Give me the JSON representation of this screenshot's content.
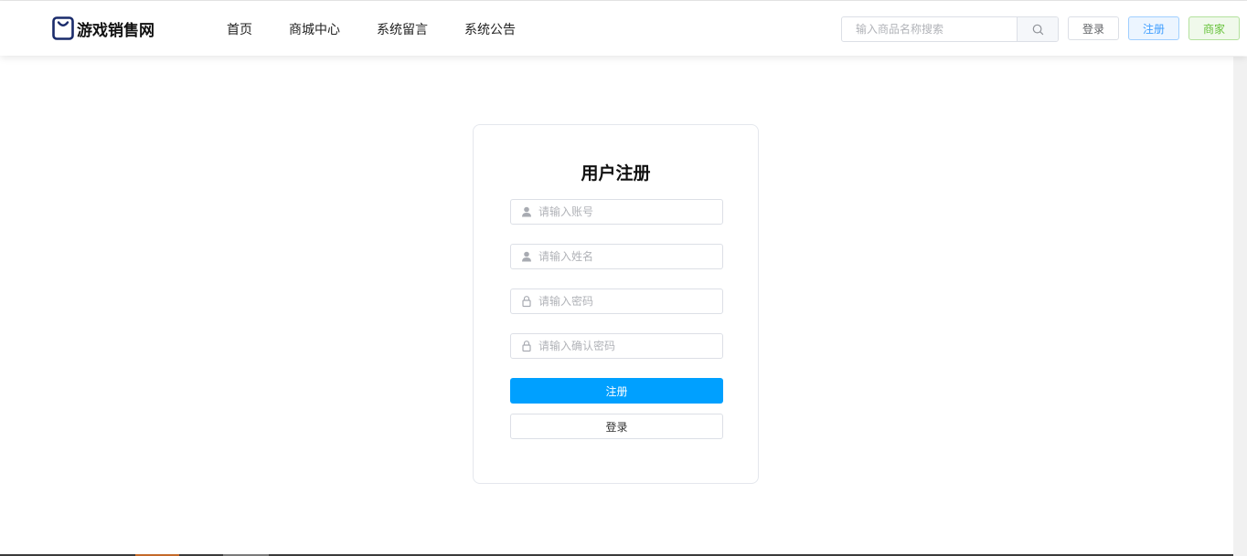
{
  "brand": {
    "name": "游戏销售网",
    "color": "#1a2b6b"
  },
  "nav": {
    "items": [
      {
        "label": "首页"
      },
      {
        "label": "商城中心"
      },
      {
        "label": "系统留言"
      },
      {
        "label": "系统公告"
      }
    ]
  },
  "search": {
    "placeholder": "输入商品名称搜索",
    "value": "",
    "icon": "search-icon"
  },
  "header_buttons": {
    "login": "登录",
    "register": "注册",
    "merchant": "商家"
  },
  "form": {
    "title": "用户注册",
    "fields": [
      {
        "placeholder": "请输入账号",
        "value": "",
        "icon": "user-icon"
      },
      {
        "placeholder": "请输入姓名",
        "value": "",
        "icon": "user-icon"
      },
      {
        "placeholder": "请输入密码",
        "value": "",
        "icon": "lock-icon"
      },
      {
        "placeholder": "请输入确认密码",
        "value": "",
        "icon": "lock-icon"
      }
    ],
    "submit_label": "注册",
    "login_label": "登录"
  },
  "colors": {
    "primary": "#00a0ff",
    "register_btn_text": "#409eff",
    "merchant_btn_text": "#67c23a",
    "border": "#dcdfe6",
    "placeholder": "#b1b3b8"
  }
}
